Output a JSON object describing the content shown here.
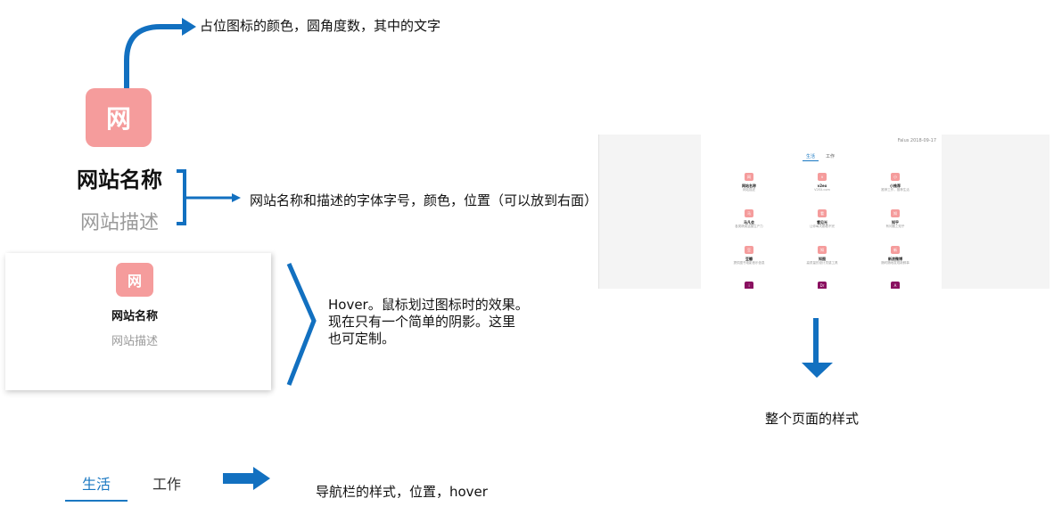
{
  "annotations": {
    "icon_note": "占位图标的颜色，圆角度数，其中的文字",
    "name_note": "网站名称和描述的字体字号，颜色，位置（可以放到右面）",
    "hover_note_lines": [
      "Hover。鼠标划过图标时的效果。",
      "现在只有一个简单的阴影。这里",
      "也可定制。"
    ],
    "nav_note": "导航栏的样式，位置，hover",
    "page_style_note": "整个页面的样式"
  },
  "example": {
    "icon_text": "网",
    "site_name": "网站名称",
    "site_desc": "网站描述"
  },
  "nav": {
    "tabs": [
      {
        "label": "生活",
        "active": true
      },
      {
        "label": "工作",
        "active": false
      }
    ]
  },
  "preview": {
    "date": "Falus 2018-09-17",
    "tabs": [
      "生活",
      "工作"
    ],
    "items": [
      {
        "icon": "网",
        "name": "网站名称",
        "desc": "网站描述",
        "dark": false
      },
      {
        "icon": "v",
        "name": "v2ex",
        "desc": "V2EX.com",
        "dark": false
      },
      {
        "icon": "小",
        "name": "小推荐",
        "desc": "推荐工作，推荐生活",
        "dark": false
      },
      {
        "icon": "马",
        "name": "马凡会",
        "desc": "各类精英运营生产力",
        "dark": false
      },
      {
        "icon": "看",
        "name": "看见光",
        "desc": "让你每天都看不完",
        "dark": false
      },
      {
        "icon": "知",
        "name": "知乎",
        "desc": "有问题上知乎",
        "dark": false
      },
      {
        "icon": "豆",
        "name": "豆瓣",
        "desc": "提供图书电影音乐信息",
        "dark": false
      },
      {
        "icon": "知",
        "name": "知图",
        "desc": "高质量的设计灵感工具",
        "dark": false
      },
      {
        "icon": "新",
        "name": "新浪微博",
        "desc": "随时随地发现新鲜事",
        "dark": false
      },
      {
        "icon": "i",
        "name": "",
        "desc": "",
        "dark": true
      },
      {
        "icon": "Dr",
        "name": "",
        "desc": "",
        "dark": true
      },
      {
        "icon": "A",
        "name": "",
        "desc": "",
        "dark": true
      }
    ]
  },
  "colors": {
    "icon_bg": "#f59c9c",
    "accent": "#1a78c2",
    "arrow": "#1270c0",
    "desc_gray": "#9a9a9a"
  }
}
